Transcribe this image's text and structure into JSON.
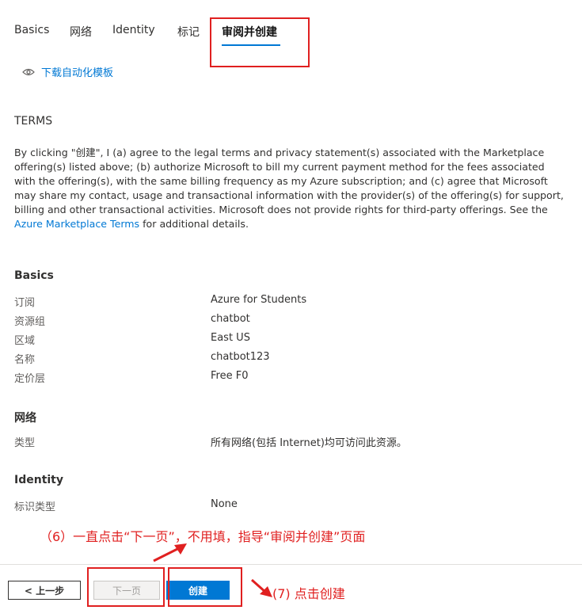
{
  "tabs": [
    {
      "label": "Basics"
    },
    {
      "label": "网络"
    },
    {
      "label": "Identity"
    },
    {
      "label": "标记"
    },
    {
      "label": "审阅并创建"
    }
  ],
  "download_template": {
    "label": "下载自动化模板",
    "icon": "eye-icon"
  },
  "terms": {
    "title": "TERMS",
    "body_before_link": "By clicking \"创建\", I (a) agree to the legal terms and privacy statement(s) associated with the Marketplace offering(s) listed above; (b) authorize Microsoft to bill my current payment method for the fees associated with the offering(s), with the same billing frequency as my Azure subscription; and (c) agree that Microsoft may share my contact, usage and transactional information with the provider(s) of the offering(s) for support, billing and other transactional activities. Microsoft does not provide rights for third-party offerings. See the ",
    "link": "Azure Marketplace Terms",
    "body_after_link": " for additional details."
  },
  "sections": {
    "basics": {
      "title": "Basics",
      "rows": [
        {
          "label": "订阅",
          "value": "Azure for Students"
        },
        {
          "label": "资源组",
          "value": "chatbot"
        },
        {
          "label": "区域",
          "value": "East US"
        },
        {
          "label": "名称",
          "value": "chatbot123"
        },
        {
          "label": "定价层",
          "value": "Free F0"
        }
      ]
    },
    "network": {
      "title": "网络",
      "rows": [
        {
          "label": "类型",
          "value": "所有网络(包括 Internet)均可访问此资源。"
        }
      ]
    },
    "identity": {
      "title": "Identity",
      "rows": [
        {
          "label": "标识类型",
          "value": "None"
        }
      ]
    }
  },
  "annotations": {
    "step6": "（6）一直点击“下一页”，不用填，指导“审阅并创建”页面",
    "step7": "(7) 点击创建"
  },
  "footer": {
    "prev_label": "< 上一步",
    "next_label": "下一页",
    "create_label": "创建"
  },
  "colors": {
    "accent": "#0078d4",
    "annotation_red": "#e02020"
  }
}
